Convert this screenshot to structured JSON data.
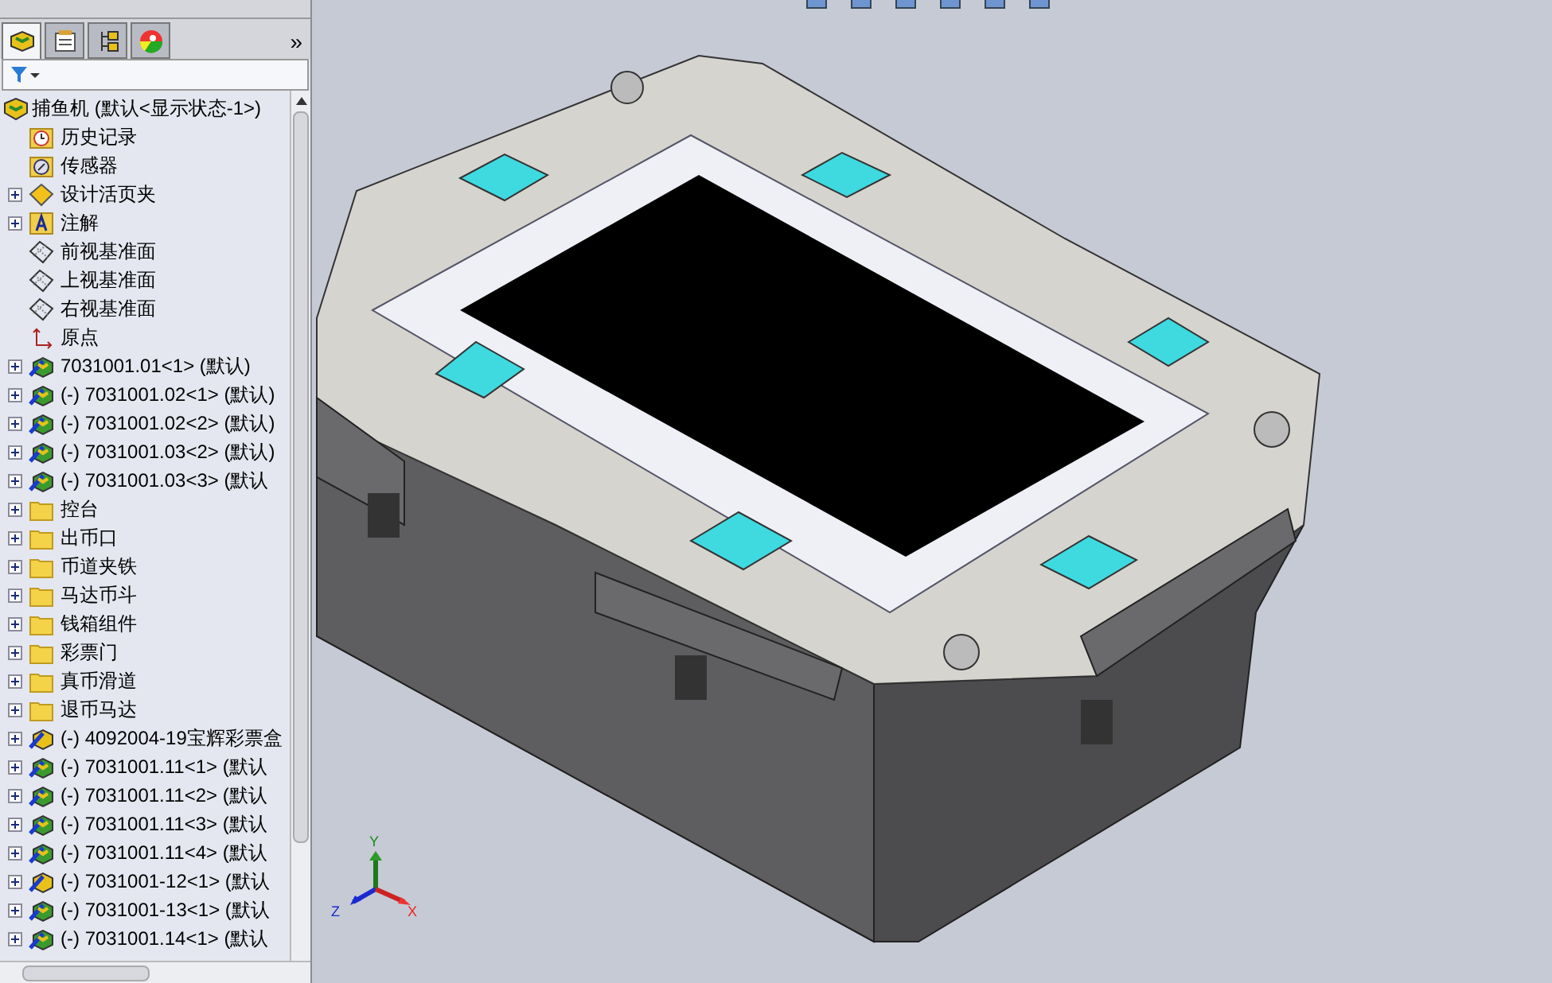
{
  "panel": {
    "tabs": [
      {
        "kind": "tree",
        "selected": true
      },
      {
        "kind": "property",
        "selected": false
      },
      {
        "kind": "config",
        "selected": false
      },
      {
        "kind": "display",
        "selected": false
      }
    ],
    "more": "»"
  },
  "tree": [
    {
      "kind": "assembly",
      "label": "捕鱼机 (默认<显示状态-1>)",
      "expandable": false,
      "root": true
    },
    {
      "kind": "history",
      "label": "历史记录",
      "expandable": false
    },
    {
      "kind": "sensor",
      "label": "传感器",
      "expandable": false
    },
    {
      "kind": "binder",
      "label": "设计活页夹",
      "expandable": true
    },
    {
      "kind": "annotation",
      "label": "注解",
      "expandable": true
    },
    {
      "kind": "plane",
      "label": "前视基准面",
      "expandable": false
    },
    {
      "kind": "plane",
      "label": "上视基准面",
      "expandable": false
    },
    {
      "kind": "plane",
      "label": "右视基准面",
      "expandable": false
    },
    {
      "kind": "origin",
      "label": "原点",
      "expandable": false
    },
    {
      "kind": "part",
      "label": "7031001.01<1> (默认)",
      "expandable": true
    },
    {
      "kind": "part",
      "label": "(-) 7031001.02<1> (默认)",
      "expandable": true
    },
    {
      "kind": "part",
      "label": "(-) 7031001.02<2> (默认)",
      "expandable": true
    },
    {
      "kind": "part",
      "label": "(-) 7031001.03<2> (默认)",
      "expandable": true
    },
    {
      "kind": "part",
      "label": "(-) 7031001.03<3> (默认",
      "expandable": true
    },
    {
      "kind": "folder",
      "label": "控台",
      "expandable": true
    },
    {
      "kind": "folder",
      "label": "出币口",
      "expandable": true
    },
    {
      "kind": "folder",
      "label": "币道夹铁",
      "expandable": true
    },
    {
      "kind": "folder",
      "label": "马达币斗",
      "expandable": true
    },
    {
      "kind": "folder",
      "label": "钱箱组件",
      "expandable": true
    },
    {
      "kind": "folder",
      "label": "彩票门",
      "expandable": true
    },
    {
      "kind": "folder",
      "label": "真币滑道",
      "expandable": true
    },
    {
      "kind": "folder",
      "label": "退币马达",
      "expandable": true
    },
    {
      "kind": "subassembly",
      "label": "(-) 4092004-19宝辉彩票盒",
      "expandable": true
    },
    {
      "kind": "part",
      "label": "(-) 7031001.11<1> (默认",
      "expandable": true
    },
    {
      "kind": "part",
      "label": "(-) 7031001.11<2> (默认",
      "expandable": true
    },
    {
      "kind": "part",
      "label": "(-) 7031001.11<3> (默认",
      "expandable": true
    },
    {
      "kind": "part",
      "label": "(-) 7031001.11<4> (默认",
      "expandable": true
    },
    {
      "kind": "subassembly",
      "label": "(-) 7031001-12<1> (默认",
      "expandable": true
    },
    {
      "kind": "part",
      "label": "(-) 7031001-13<1> (默认",
      "expandable": true
    },
    {
      "kind": "part",
      "label": "(-) 7031001.14<1> (默认",
      "expandable": true
    }
  ],
  "triad": {
    "x": "X",
    "y": "Y",
    "z": "Z"
  }
}
